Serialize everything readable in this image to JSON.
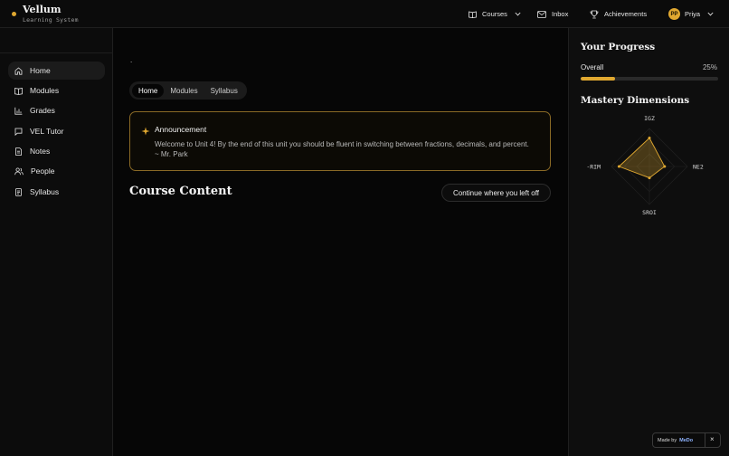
{
  "brand": {
    "name": "Vellum",
    "subtitle": "Learning System"
  },
  "topnav": {
    "courses": "Courses",
    "inbox": "Inbox",
    "achievements": "Achievements",
    "user_initials": "PP",
    "user_name": "Priya"
  },
  "sidebar": {
    "items": [
      {
        "label": "Home",
        "icon": "home-icon",
        "active": true
      },
      {
        "label": "Modules",
        "icon": "book-icon"
      },
      {
        "label": "Grades",
        "icon": "bar-chart-icon"
      },
      {
        "label": "VEL Tutor",
        "icon": "chat-icon"
      },
      {
        "label": "Notes",
        "icon": "note-icon"
      },
      {
        "label": "People",
        "icon": "people-icon"
      },
      {
        "label": "Syllabus",
        "icon": "document-icon"
      }
    ]
  },
  "main": {
    "dot": ".",
    "tabs": [
      "Home",
      "Modules",
      "Syllabus"
    ],
    "active_tab": "Home",
    "announcement": {
      "title": "Announcement",
      "body": "Welcome to Unit 4! By the end of this unit you should be fluent in switching between fractions, decimals, and percent. ~ Mr. Park"
    },
    "content_title": "Course Content",
    "continue_label": "Continue where you left off"
  },
  "progress": {
    "title": "Your Progress",
    "overall_label": "Overall",
    "overall_pct_text": "25%",
    "overall_fraction": 0.25,
    "accent": "#e0a830"
  },
  "mastery": {
    "title": "Mastery Dimensions",
    "axes": [
      "IGZ",
      "NE2",
      "SROI",
      "-RIM"
    ],
    "values": [
      0.75,
      0.4,
      0.3,
      0.8
    ]
  },
  "madeby": {
    "text": "Made by",
    "logo": "MeDo",
    "close": "×"
  }
}
